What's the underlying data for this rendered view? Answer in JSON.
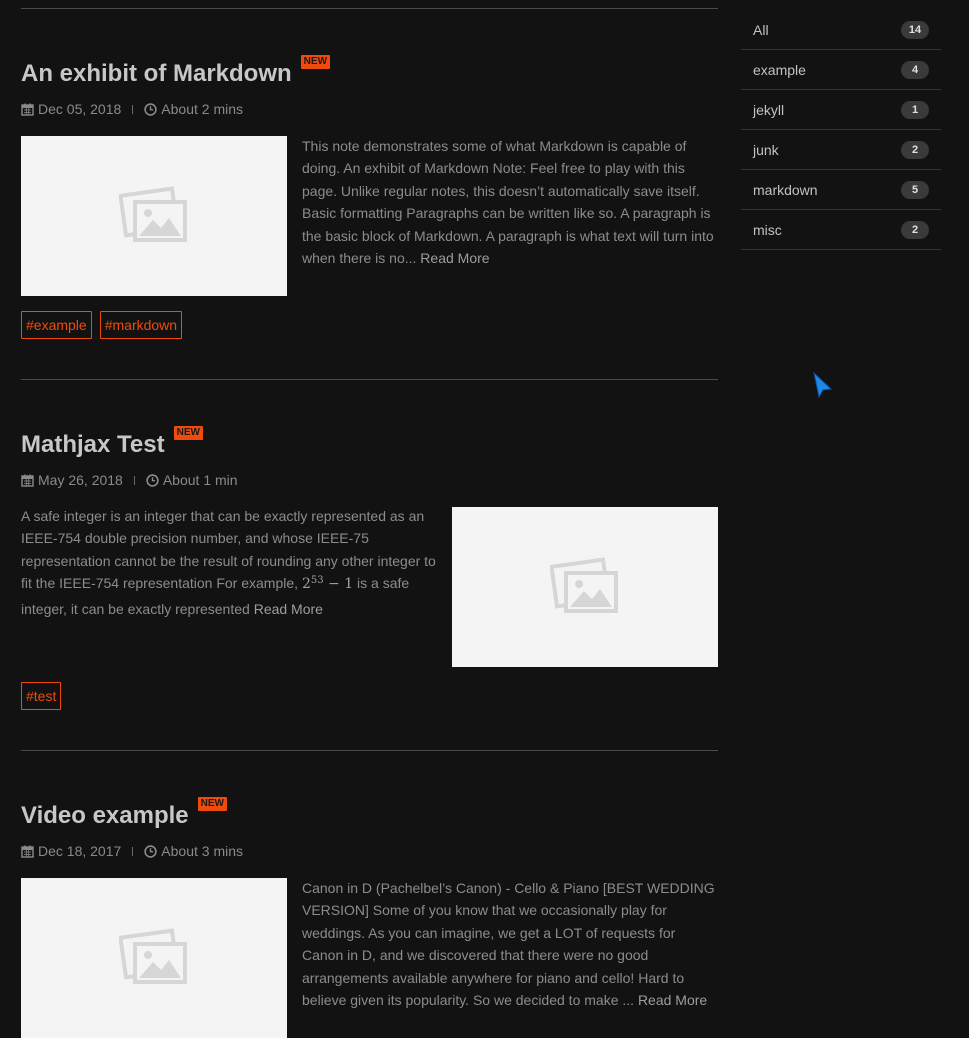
{
  "posts": [
    {
      "title": "An exhibit of Markdown",
      "badge": "NEW",
      "date": "Dec 05, 2018",
      "read_time": "About 2 mins",
      "excerpt": "This note demonstrates some of what Markdown is capable of doing. An exhibit of Markdown Note: Feel free to play with this page. Unlike regular notes, this doesn’t automatically save itself. Basic formatting Paragraphs can be written like so. A paragraph is the basic block of Markdown. A paragraph is what text will turn into when there is no...",
      "read_more": "Read More",
      "tags": [
        "#example",
        "#markdown"
      ]
    },
    {
      "title": "Mathjax Test",
      "badge": "NEW",
      "date": "May 26, 2018",
      "read_time": "About 1 min",
      "excerpt_before": "A safe integer is an integer that can be exactly represented as an IEEE-754 double precision number, and whose IEEE-75 representation cannot be the result of rounding any other integer to fit the IEEE-754 representation For example,",
      "math_base": "2",
      "math_exp": "53",
      "math_rest": "− 1",
      "excerpt_after": "is a safe integer, it can be exactly represented",
      "read_more": "Read More",
      "tags": [
        "#test"
      ]
    },
    {
      "title": "Video example",
      "badge": "NEW",
      "date": "Dec 18, 2017",
      "read_time": "About 3 mins",
      "excerpt": "Canon in D (Pachelbel’s Canon) - Cello & Piano [BEST WEDDING VERSION] Some of you know that we occasionally play for weddings. As you can imagine, we get a LOT of requests for Canon in D, and we discovered that there were no good arrangements available anywhere for piano and cello! Hard to believe given its popularity. So we decided to make ...",
      "read_more": "Read More"
    }
  ],
  "categories": [
    {
      "name": "All",
      "count": "14"
    },
    {
      "name": "example",
      "count": "4"
    },
    {
      "name": "jekyll",
      "count": "1"
    },
    {
      "name": "junk",
      "count": "2"
    },
    {
      "name": "markdown",
      "count": "5"
    },
    {
      "name": "misc",
      "count": "2"
    }
  ],
  "colors": {
    "background": "#121212",
    "accent": "#ee4b0c",
    "title": "#c7c7c7",
    "text": "#8c8c8c",
    "placeholder": "#f4f4f4"
  },
  "icons": {
    "date": "calendar-icon",
    "read_time": "clock-icon",
    "thumbnail": "image-placeholder-icon",
    "cursor": "mouse-pointer-icon"
  }
}
